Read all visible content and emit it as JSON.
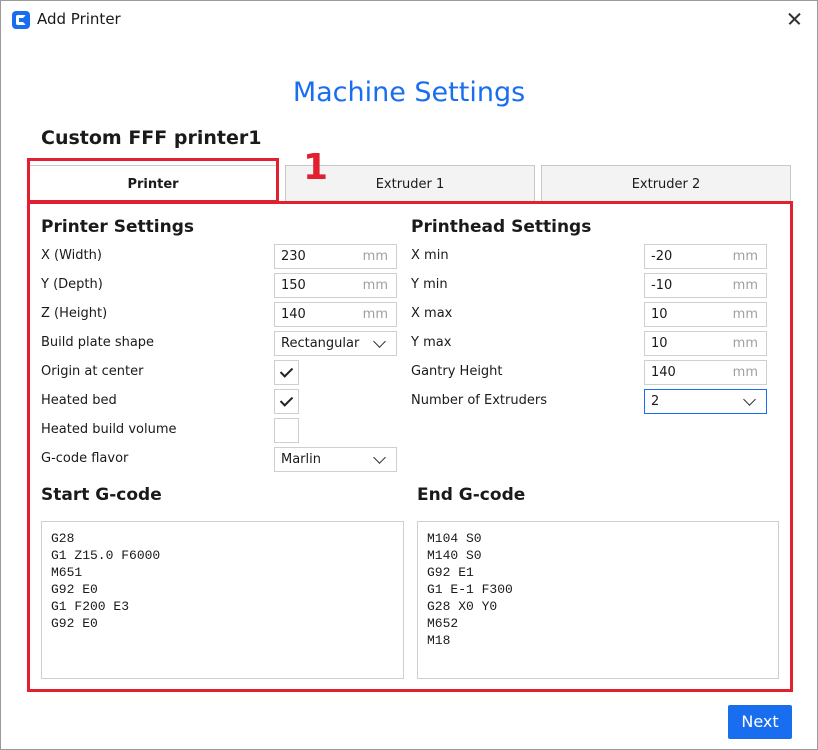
{
  "window": {
    "title": "Add Printer"
  },
  "page": {
    "heading": "Machine Settings",
    "printer_name": "Custom FFF printer1"
  },
  "tabs": [
    {
      "label": "Printer",
      "active": true
    },
    {
      "label": "Extruder 1",
      "active": false
    },
    {
      "label": "Extruder 2",
      "active": false
    }
  ],
  "annotation": {
    "number": "1",
    "color": "#e1212f"
  },
  "printer_settings": {
    "title": "Printer Settings",
    "x_width": {
      "label": "X (Width)",
      "value": "230",
      "unit": "mm"
    },
    "y_depth": {
      "label": "Y (Depth)",
      "value": "150",
      "unit": "mm"
    },
    "z_height": {
      "label": "Z (Height)",
      "value": "140",
      "unit": "mm"
    },
    "build_plate_shape": {
      "label": "Build plate shape",
      "value": "Rectangular"
    },
    "origin_at_center": {
      "label": "Origin at center",
      "checked": true
    },
    "heated_bed": {
      "label": "Heated bed",
      "checked": true
    },
    "heated_build_volume": {
      "label": "Heated build volume",
      "checked": false
    },
    "gcode_flavor": {
      "label": "G-code flavor",
      "value": "Marlin"
    }
  },
  "printhead_settings": {
    "title": "Printhead Settings",
    "x_min": {
      "label": "X min",
      "value": "-20",
      "unit": "mm"
    },
    "y_min": {
      "label": "Y min",
      "value": "-10",
      "unit": "mm"
    },
    "x_max": {
      "label": "X max",
      "value": "10",
      "unit": "mm"
    },
    "y_max": {
      "label": "Y max",
      "value": "10",
      "unit": "mm"
    },
    "gantry_height": {
      "label": "Gantry Height",
      "value": "140",
      "unit": "mm"
    },
    "number_of_extruders": {
      "label": "Number of Extruders",
      "value": "2"
    }
  },
  "start_gcode": {
    "title": "Start G-code",
    "code": "G28\nG1 Z15.0 F6000\nM651\nG92 E0\nG1 F200 E3\nG92 E0"
  },
  "end_gcode": {
    "title": "End G-code",
    "code": "M104 S0\nM140 S0\nG92 E1\nG1 E-1 F300\nG28 X0 Y0\nM652\nM18"
  },
  "footer": {
    "next_label": "Next"
  },
  "colors": {
    "accent": "#196ef0",
    "highlight": "#e1212f"
  }
}
